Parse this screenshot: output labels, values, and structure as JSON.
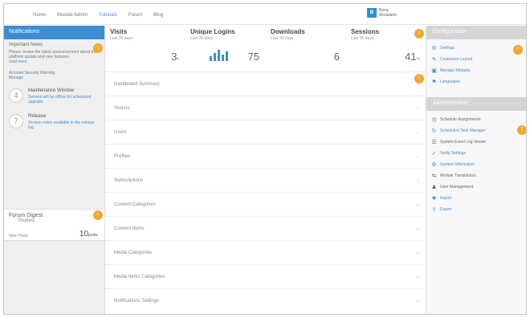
{
  "topnav": [
    "Home",
    "Module Admin",
    "Tutorials",
    "Forum",
    "Blog"
  ],
  "brand": {
    "mark": "B",
    "text": "Bona Modulator"
  },
  "left": {
    "header": "Notifications",
    "block1": {
      "title": "Important News",
      "text": "Please review the latest announcement about the platform update and new features.",
      "link": "read more"
    },
    "block2": {
      "title": "Account Security Warning",
      "link": "Manage"
    },
    "news": [
      {
        "date": "4",
        "title": "Maintenance Window",
        "desc": "Servers will be offline for scheduled upgrade."
      },
      {
        "date": "7",
        "title": "Release",
        "desc": "Version notes available in the release log."
      }
    ],
    "forum": {
      "title": "Forum Digest",
      "sub": "Replies",
      "label": "New Posts",
      "count": "10",
      "unit": "posts"
    }
  },
  "stats": [
    {
      "name": "Visits",
      "sub": "Last 30 days",
      "value": "3",
      "unit": "k"
    },
    {
      "name": "Unique Logins",
      "sub": "Last 30 days",
      "value": "75",
      "unit": ""
    },
    {
      "name": "Downloads",
      "sub": "Last 30 days",
      "value": "6",
      "unit": ""
    },
    {
      "name": "Sessions",
      "sub": "Last 30 days",
      "value": "41",
      "unit": "%"
    }
  ],
  "panels": [
    "Dashboard Summary",
    "Visitors",
    "Users",
    "Profiles",
    "Subscriptions",
    "Content Categories",
    "Content Items",
    "Media Categories",
    "Media Items Categories",
    "Notifications Settings"
  ],
  "right": {
    "header1": "Configuration",
    "config": [
      {
        "icon": "settings-icon",
        "glyph": "⚙",
        "label": "Settings"
      },
      {
        "icon": "pencil-icon",
        "glyph": "✎",
        "label": "Customize Layout"
      },
      {
        "icon": "window-icon",
        "glyph": "▣",
        "label": "Manage Widgets"
      },
      {
        "icon": "flag-icon",
        "glyph": "⚑",
        "label": "Languages"
      }
    ],
    "header2": "Administration",
    "admin": [
      {
        "icon": "clock-icon",
        "glyph": "◷",
        "label": "Schedule Assignments"
      },
      {
        "icon": "refresh-icon",
        "glyph": "↻",
        "label": "Scheduled Task Manager"
      },
      {
        "icon": "list-icon",
        "glyph": "☰",
        "label": "System Event Log Viewer"
      },
      {
        "icon": "tools-icon",
        "glyph": "✓",
        "label": "Verify Settings"
      },
      {
        "icon": "cog-icon",
        "glyph": "⚙",
        "label": "System Information"
      },
      {
        "icon": "translate-icon",
        "glyph": "⇆",
        "label": "Module Translations"
      },
      {
        "icon": "users-icon",
        "glyph": "♟",
        "label": "User Management"
      },
      {
        "icon": "plus-icon",
        "glyph": "✚",
        "label": "Import"
      },
      {
        "icon": "export-icon",
        "glyph": "⇪",
        "label": "Export"
      }
    ]
  }
}
